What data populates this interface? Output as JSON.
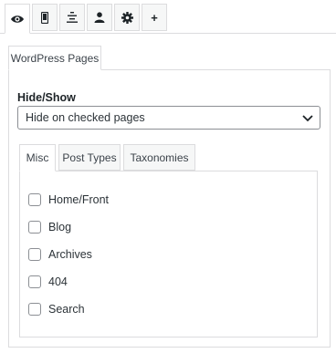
{
  "icon_tabs": [
    {
      "icon": "eye-icon"
    },
    {
      "icon": "mobile-icon"
    },
    {
      "icon": "align-center-icon"
    },
    {
      "icon": "user-icon"
    },
    {
      "icon": "gear-icon"
    },
    {
      "icon": "plus-icon",
      "label": "+"
    }
  ],
  "panel": {
    "tab_label": "WordPress Pages",
    "hide_show_label": "Hide/Show",
    "select_value": "Hide on checked pages"
  },
  "subtabs": [
    "Misc",
    "Post Types",
    "Taxonomies"
  ],
  "misc_options": [
    {
      "label": "Home/Front",
      "checked": false
    },
    {
      "label": "Blog",
      "checked": false
    },
    {
      "label": "Archives",
      "checked": false
    },
    {
      "label": "404",
      "checked": false
    },
    {
      "label": "Search",
      "checked": false
    }
  ]
}
